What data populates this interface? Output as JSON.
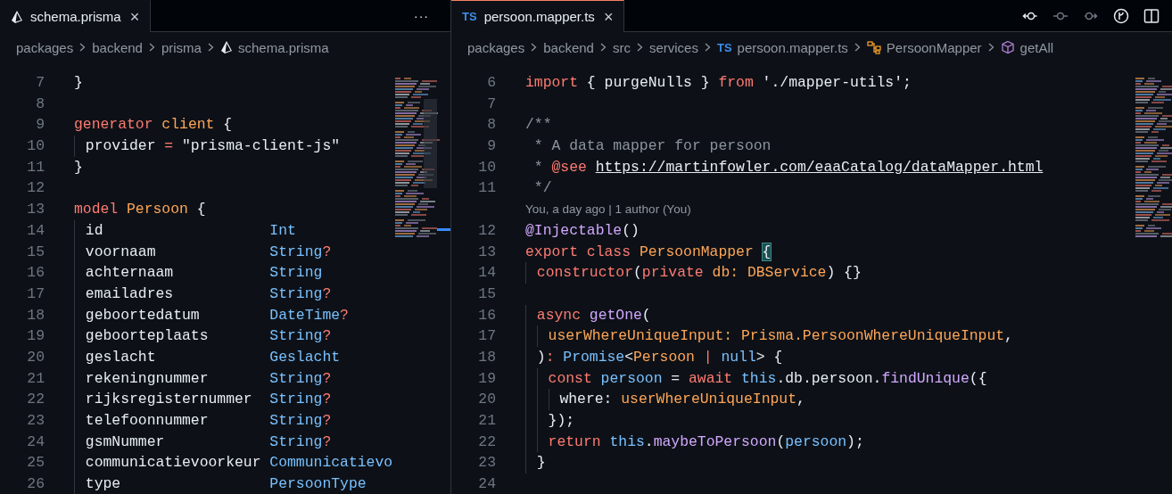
{
  "panes": [
    {
      "focused": false,
      "tabs": [
        {
          "label": "schema.prisma",
          "kind": "prisma",
          "close": "×",
          "selected": true
        }
      ],
      "more": "···",
      "breadcrumb": [
        {
          "label": "packages",
          "kind": "folder"
        },
        {
          "label": "backend",
          "kind": "folder"
        },
        {
          "label": "prisma",
          "kind": "folder"
        },
        {
          "label": "schema.prisma",
          "kind": "prisma"
        }
      ],
      "lines": [
        {
          "number": "7",
          "tokens": [
            {
              "text": "}",
              "kind": "plain"
            }
          ]
        },
        {
          "number": "8"
        },
        {
          "number": "9",
          "tokens": [
            {
              "text": "generator",
              "kind": "keyword"
            },
            {
              "text": " client",
              "kind": "name"
            },
            {
              "text": " {",
              "kind": "plain"
            }
          ]
        },
        {
          "number": "10",
          "tokens": [
            {
              "text": "  provider ",
              "kind": "plain"
            },
            {
              "text": "=",
              "kind": "keyword"
            },
            {
              "text": " \"prisma-client-js\"",
              "kind": "plain"
            }
          ]
        },
        {
          "number": "11",
          "tokens": [
            {
              "text": "}",
              "kind": "plain"
            }
          ]
        },
        {
          "number": "12"
        },
        {
          "number": "13",
          "tokens": [
            {
              "text": "model",
              "kind": "keyword"
            },
            {
              "text": " Persoon",
              "kind": "name"
            },
            {
              "text": " {",
              "kind": "plain"
            }
          ]
        },
        {
          "number": "14",
          "tokens": [
            {
              "text": "  id                   ",
              "kind": "plain"
            },
            {
              "text": "Int",
              "kind": "type"
            }
          ]
        },
        {
          "number": "15",
          "tokens": [
            {
              "text": "  voornaam             ",
              "kind": "plain"
            },
            {
              "text": "String",
              "kind": "type"
            },
            {
              "text": "?",
              "kind": "keyword"
            }
          ]
        },
        {
          "number": "16",
          "tokens": [
            {
              "text": "  achternaam           ",
              "kind": "plain"
            },
            {
              "text": "String",
              "kind": "type"
            }
          ]
        },
        {
          "number": "17",
          "tokens": [
            {
              "text": "  emailadres           ",
              "kind": "plain"
            },
            {
              "text": "String",
              "kind": "type"
            },
            {
              "text": "?",
              "kind": "keyword"
            }
          ]
        },
        {
          "number": "18",
          "tokens": [
            {
              "text": "  geboortedatum        ",
              "kind": "plain"
            },
            {
              "text": "DateTime",
              "kind": "type"
            },
            {
              "text": "?",
              "kind": "keyword"
            }
          ]
        },
        {
          "number": "19",
          "tokens": [
            {
              "text": "  geboorteplaats       ",
              "kind": "plain"
            },
            {
              "text": "String",
              "kind": "type"
            },
            {
              "text": "?",
              "kind": "keyword"
            }
          ]
        },
        {
          "number": "20",
          "tokens": [
            {
              "text": "  geslacht             ",
              "kind": "plain"
            },
            {
              "text": "Geslacht",
              "kind": "type"
            }
          ]
        },
        {
          "number": "21",
          "tokens": [
            {
              "text": "  rekeningnummer       ",
              "kind": "plain"
            },
            {
              "text": "String",
              "kind": "type"
            },
            {
              "text": "?",
              "kind": "keyword"
            }
          ]
        },
        {
          "number": "22",
          "tokens": [
            {
              "text": "  rijksregisternummer  ",
              "kind": "plain"
            },
            {
              "text": "String",
              "kind": "type"
            },
            {
              "text": "?",
              "kind": "keyword"
            }
          ]
        },
        {
          "number": "23",
          "tokens": [
            {
              "text": "  telefoonnummer       ",
              "kind": "plain"
            },
            {
              "text": "String",
              "kind": "type"
            },
            {
              "text": "?",
              "kind": "keyword"
            }
          ]
        },
        {
          "number": "24",
          "tokens": [
            {
              "text": "  gsmNummer            ",
              "kind": "plain"
            },
            {
              "text": "String",
              "kind": "type"
            },
            {
              "text": "?",
              "kind": "keyword"
            }
          ]
        },
        {
          "number": "25",
          "tokens": [
            {
              "text": "  communicatievoorkeur ",
              "kind": "plain"
            },
            {
              "text": "Communicatievo",
              "kind": "type"
            }
          ]
        },
        {
          "number": "26",
          "tokens": [
            {
              "text": "  type                 ",
              "kind": "plain"
            },
            {
              "text": "PersoonType",
              "kind": "type"
            }
          ]
        }
      ]
    },
    {
      "focused": true,
      "tabs": [
        {
          "label": "persoon.mapper.ts",
          "kind": "ts",
          "icon": "TS",
          "close": "×",
          "selected": true
        }
      ],
      "toolbar": [
        {
          "kind": "commit-back",
          "disabled": false
        },
        {
          "kind": "commit",
          "disabled": true
        },
        {
          "kind": "commit-forward",
          "disabled": true
        },
        {
          "kind": "branch",
          "disabled": false
        },
        {
          "kind": "split",
          "disabled": false
        }
      ],
      "breadcrumb": [
        {
          "label": "packages",
          "kind": "folder"
        },
        {
          "label": "backend",
          "kind": "folder"
        },
        {
          "label": "src",
          "kind": "folder"
        },
        {
          "label": "services",
          "kind": "folder"
        },
        {
          "label": "persoon.mapper.ts",
          "kind": "ts",
          "icon": "TS"
        },
        {
          "label": "PersoonMapper",
          "kind": "class"
        },
        {
          "label": "getAll",
          "kind": "method"
        }
      ],
      "lines": [
        {
          "number": "6",
          "tokens": [
            {
              "text": "import",
              "kind": "keyword"
            },
            {
              "text": " { purgeNulls } ",
              "kind": "plain"
            },
            {
              "text": "from",
              "kind": "keyword"
            },
            {
              "text": " './mapper-utils';",
              "kind": "plain"
            }
          ]
        },
        {
          "number": "7"
        },
        {
          "number": "8",
          "tokens": [
            {
              "text": "/**",
              "kind": "comment"
            }
          ]
        },
        {
          "number": "9",
          "tokens": [
            {
              "text": " * A data mapper for persoon",
              "kind": "comment"
            }
          ]
        },
        {
          "number": "10",
          "tokens": [
            {
              "text": " * ",
              "kind": "comment"
            },
            {
              "text": "@see ",
              "kind": "keyword"
            },
            {
              "text": "https://martinfowler.com/eaaCatalog/dataMapper.html",
              "kind": "link"
            }
          ]
        },
        {
          "number": "11",
          "tokens": [
            {
              "text": " */",
              "kind": "comment"
            }
          ],
          "codelens": "You, a day ago | 1 author (You)"
        },
        {
          "number": "12",
          "tokens": [
            {
              "text": "@Injectable",
              "kind": "function"
            },
            {
              "text": "()",
              "kind": "plain"
            }
          ]
        },
        {
          "number": "13",
          "tokens": [
            {
              "text": "export class",
              "kind": "keyword"
            },
            {
              "text": " PersoonMapper ",
              "kind": "name"
            },
            {
              "text": "{",
              "kind": "bracket"
            }
          ]
        },
        {
          "number": "14",
          "tokens": [
            {
              "text": "  constructor",
              "kind": "keyword"
            },
            {
              "text": "(",
              "kind": "plain"
            },
            {
              "text": "private",
              "kind": "keyword"
            },
            {
              "text": " db: DBService",
              "kind": "name"
            },
            {
              "text": ") {}",
              "kind": "plain"
            }
          ]
        },
        {
          "number": "15"
        },
        {
          "number": "16",
          "tokens": [
            {
              "text": "  async",
              "kind": "keyword"
            },
            {
              "text": " getOne",
              "kind": "function"
            },
            {
              "text": "(",
              "kind": "plain"
            }
          ]
        },
        {
          "number": "17",
          "tokens": [
            {
              "text": "    userWhereUniqueInput: Prisma.PersoonWhereUniqueInput",
              "kind": "name"
            },
            {
              "text": ",",
              "kind": "plain"
            }
          ]
        },
        {
          "number": "18",
          "tokens": [
            {
              "text": "  )",
              "kind": "plain"
            },
            {
              "text": ":",
              "kind": "keyword"
            },
            {
              "text": " Promise",
              "kind": "type"
            },
            {
              "text": "<",
              "kind": "plain"
            },
            {
              "text": "Persoon",
              "kind": "name"
            },
            {
              "text": " |",
              "kind": "keyword"
            },
            {
              "text": " null",
              "kind": "type"
            },
            {
              "text": "> {",
              "kind": "plain"
            }
          ]
        },
        {
          "number": "19",
          "tokens": [
            {
              "text": "    const",
              "kind": "keyword"
            },
            {
              "text": " persoon",
              "kind": "type"
            },
            {
              "text": " = ",
              "kind": "plain"
            },
            {
              "text": "await",
              "kind": "keyword"
            },
            {
              "text": " this",
              "kind": "type"
            },
            {
              "text": ".db.persoon.",
              "kind": "plain"
            },
            {
              "text": "findUnique",
              "kind": "function"
            },
            {
              "text": "({",
              "kind": "plain"
            }
          ]
        },
        {
          "number": "20",
          "tokens": [
            {
              "text": "      where: ",
              "kind": "plain"
            },
            {
              "text": "userWhereUniqueInput",
              "kind": "name"
            },
            {
              "text": ",",
              "kind": "plain"
            }
          ]
        },
        {
          "number": "21",
          "tokens": [
            {
              "text": "    });",
              "kind": "plain"
            }
          ]
        },
        {
          "number": "22",
          "tokens": [
            {
              "text": "    return",
              "kind": "keyword"
            },
            {
              "text": " this",
              "kind": "type"
            },
            {
              "text": ".",
              "kind": "plain"
            },
            {
              "text": "maybeToPersoon",
              "kind": "function"
            },
            {
              "text": "(",
              "kind": "plain"
            },
            {
              "text": "persoon",
              "kind": "type"
            },
            {
              "text": ");",
              "kind": "plain"
            }
          ]
        },
        {
          "number": "23",
          "tokens": [
            {
              "text": "  }",
              "kind": "plain"
            }
          ]
        },
        {
          "number": "24"
        }
      ]
    }
  ]
}
